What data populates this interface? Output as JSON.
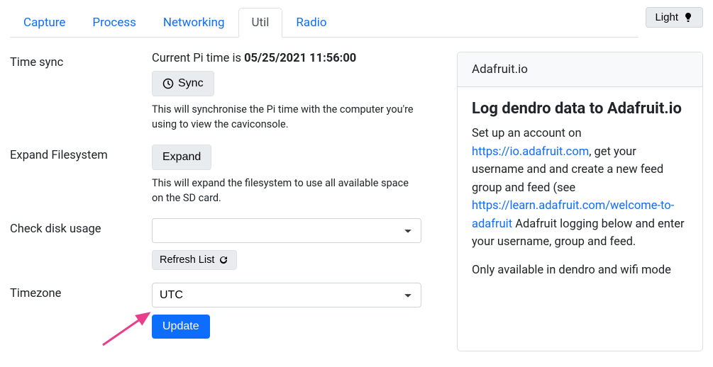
{
  "tabs": {
    "capture": "Capture",
    "process": "Process",
    "networking": "Networking",
    "util": "Util",
    "radio": "Radio"
  },
  "theme_toggle": "Light",
  "time_sync": {
    "label": "Time sync",
    "prefix": "Current Pi time is ",
    "datetime": "05/25/2021 11:56:00",
    "sync_button": "Sync",
    "help": "This will synchronise the Pi time with the computer you're using to view the caviconsole."
  },
  "expand_fs": {
    "label": "Expand Filesystem",
    "button": "Expand",
    "help": "This will expand the filesystem to use all available space on the SD card."
  },
  "disk_usage": {
    "label": "Check disk usage",
    "selected": "",
    "refresh_button": "Refresh List"
  },
  "timezone": {
    "label": "Timezone",
    "selected": "UTC",
    "update_button": "Update"
  },
  "adafruit": {
    "header": "Adafruit.io",
    "title": "Log dendro data to Adafruit.io",
    "p1_a": "Set up an account on ",
    "link1": "https://io.adafruit.com",
    "p1_b": ", get your username and ",
    "link2_pre": "and create a new feed group and feed (see ",
    "link2": "https://learn.adafruit.com/welcome-to-adafruit",
    "p1_c": "Adafruit logging below and enter your username, ",
    "p1_d": "group and feed.",
    "p2": "Only available in dendro and wifi mode"
  }
}
